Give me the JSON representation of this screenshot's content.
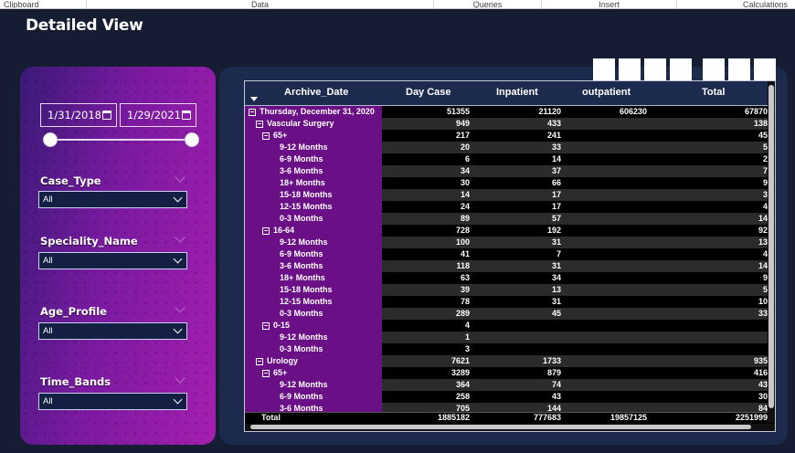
{
  "ribbon": {
    "tabs": [
      "Clipboard",
      "Data",
      "Queries",
      "Insert",
      "Calculations"
    ]
  },
  "page": {
    "title": "Detailed View"
  },
  "filters": {
    "date_start": "1/31/2018",
    "date_end": "1/29/2021",
    "slicers": [
      {
        "label": "Case_Type",
        "value": "All"
      },
      {
        "label": "Speciality_Name",
        "value": "All"
      },
      {
        "label": "Age_Profile",
        "value": "All"
      },
      {
        "label": "Time_Bands",
        "value": "All"
      }
    ]
  },
  "matrix": {
    "columns": [
      "Archive_Date",
      "Day Case",
      "Inpatient",
      "outpatient",
      "Total"
    ],
    "rows": [
      {
        "label": "Thursday, December 31, 2020",
        "level": 0,
        "expand": true,
        "day": "51355",
        "inp": "21120",
        "out": "606230",
        "total": "67870"
      },
      {
        "label": "Vascular Surgery",
        "level": 1,
        "expand": true,
        "day": "949",
        "inp": "433",
        "out": "",
        "total": "138"
      },
      {
        "label": "65+",
        "level": 2,
        "expand": true,
        "day": "217",
        "inp": "241",
        "out": "",
        "total": "45"
      },
      {
        "label": "9-12 Months",
        "level": 3,
        "expand": false,
        "day": "20",
        "inp": "33",
        "out": "",
        "total": "5"
      },
      {
        "label": "6-9 Months",
        "level": 3,
        "expand": false,
        "day": "6",
        "inp": "14",
        "out": "",
        "total": "2"
      },
      {
        "label": "3-6 Months",
        "level": 3,
        "expand": false,
        "day": "34",
        "inp": "37",
        "out": "",
        "total": "7"
      },
      {
        "label": "18+ Months",
        "level": 3,
        "expand": false,
        "day": "30",
        "inp": "66",
        "out": "",
        "total": "9"
      },
      {
        "label": "15-18 Months",
        "level": 3,
        "expand": false,
        "day": "14",
        "inp": "17",
        "out": "",
        "total": "3"
      },
      {
        "label": "12-15 Months",
        "level": 3,
        "expand": false,
        "day": "24",
        "inp": "17",
        "out": "",
        "total": "4"
      },
      {
        "label": "0-3 Months",
        "level": 3,
        "expand": false,
        "day": "89",
        "inp": "57",
        "out": "",
        "total": "14"
      },
      {
        "label": "16-64",
        "level": 2,
        "expand": true,
        "day": "728",
        "inp": "192",
        "out": "",
        "total": "92"
      },
      {
        "label": "9-12 Months",
        "level": 3,
        "expand": false,
        "day": "100",
        "inp": "31",
        "out": "",
        "total": "13"
      },
      {
        "label": "6-9 Months",
        "level": 3,
        "expand": false,
        "day": "41",
        "inp": "7",
        "out": "",
        "total": "4"
      },
      {
        "label": "3-6 Months",
        "level": 3,
        "expand": false,
        "day": "118",
        "inp": "31",
        "out": "",
        "total": "14"
      },
      {
        "label": "18+ Months",
        "level": 3,
        "expand": false,
        "day": "63",
        "inp": "34",
        "out": "",
        "total": "9"
      },
      {
        "label": "15-18 Months",
        "level": 3,
        "expand": false,
        "day": "39",
        "inp": "13",
        "out": "",
        "total": "5"
      },
      {
        "label": "12-15 Months",
        "level": 3,
        "expand": false,
        "day": "78",
        "inp": "31",
        "out": "",
        "total": "10"
      },
      {
        "label": "0-3 Months",
        "level": 3,
        "expand": false,
        "day": "289",
        "inp": "45",
        "out": "",
        "total": "33"
      },
      {
        "label": "0-15",
        "level": 2,
        "expand": true,
        "day": "4",
        "inp": "",
        "out": "",
        "total": ""
      },
      {
        "label": "9-12 Months",
        "level": 3,
        "expand": false,
        "day": "1",
        "inp": "",
        "out": "",
        "total": ""
      },
      {
        "label": "0-3 Months",
        "level": 3,
        "expand": false,
        "day": "3",
        "inp": "",
        "out": "",
        "total": ""
      },
      {
        "label": "Urology",
        "level": 1,
        "expand": true,
        "day": "7621",
        "inp": "1733",
        "out": "",
        "total": "935"
      },
      {
        "label": "65+",
        "level": 2,
        "expand": true,
        "day": "3289",
        "inp": "879",
        "out": "",
        "total": "416"
      },
      {
        "label": "9-12 Months",
        "level": 3,
        "expand": false,
        "day": "364",
        "inp": "74",
        "out": "",
        "total": "43"
      },
      {
        "label": "6-9 Months",
        "level": 3,
        "expand": false,
        "day": "258",
        "inp": "43",
        "out": "",
        "total": "30"
      },
      {
        "label": "3-6 Months",
        "level": 3,
        "expand": false,
        "day": "705",
        "inp": "144",
        "out": "",
        "total": "84"
      }
    ],
    "total": {
      "label": "Total",
      "day": "1885182",
      "inp": "777683",
      "out": "19857125",
      "total": "2251999"
    }
  }
}
